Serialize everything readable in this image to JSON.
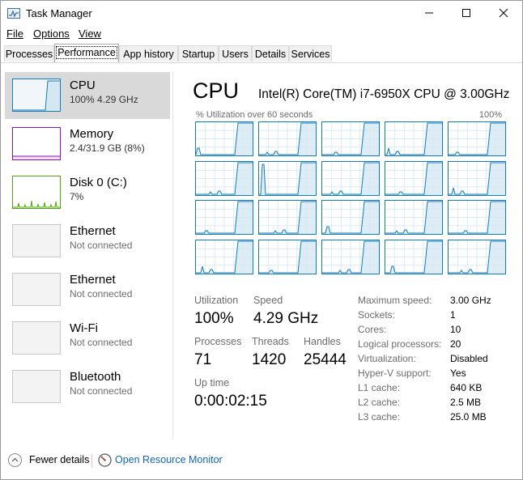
{
  "window": {
    "title": "Task Manager",
    "icon": "task-manager-icon"
  },
  "menu": [
    {
      "label": "File"
    },
    {
      "label": "Options"
    },
    {
      "label": "View"
    }
  ],
  "tabs": [
    {
      "label": "Processes"
    },
    {
      "label": "Performance",
      "active": true
    },
    {
      "label": "App history"
    },
    {
      "label": "Startup"
    },
    {
      "label": "Users"
    },
    {
      "label": "Details"
    },
    {
      "label": "Services"
    }
  ],
  "sidebar": {
    "items": [
      {
        "name": "CPU",
        "sub": "100% 4.29 GHz",
        "selected": true
      },
      {
        "name": "Memory",
        "sub": "2.4/31.9 GB (8%)"
      },
      {
        "name": "Disk 0 (C:)",
        "sub": "7%"
      },
      {
        "name": "Ethernet",
        "sub": "Not connected"
      },
      {
        "name": "Ethernet",
        "sub": "Not connected"
      },
      {
        "name": "Wi-Fi",
        "sub": "Not connected"
      },
      {
        "name": "Bluetooth",
        "sub": "Not connected"
      }
    ]
  },
  "main": {
    "title": "CPU",
    "model": "Intel(R) Core(TM) i7-6950X CPU @ 3.00GHz",
    "graph_caption": "% Utilization over 60 seconds",
    "graph_max": "100%",
    "logical_graph_count": 20,
    "stats": {
      "utilization_label": "Utilization",
      "utilization": "100%",
      "speed_label": "Speed",
      "speed": "4.29 GHz",
      "processes_label": "Processes",
      "processes": "71",
      "threads_label": "Threads",
      "threads": "1420",
      "handles_label": "Handles",
      "handles": "25444",
      "uptime_label": "Up time",
      "uptime": "0:00:02:15"
    },
    "details": [
      {
        "key": "Maximum speed:",
        "value": "3.00 GHz"
      },
      {
        "key": "Sockets:",
        "value": "1"
      },
      {
        "key": "Cores:",
        "value": "10"
      },
      {
        "key": "Logical processors:",
        "value": "20"
      },
      {
        "key": "Virtualization:",
        "value": "Disabled"
      },
      {
        "key": "Hyper-V support:",
        "value": "Yes"
      },
      {
        "key": "L1 cache:",
        "value": "640 KB"
      },
      {
        "key": "L2 cache:",
        "value": "2.5 MB"
      },
      {
        "key": "L3 cache:",
        "value": "25.0 MB"
      }
    ]
  },
  "footer": {
    "fewer_details": "Fewer details",
    "resource_monitor": "Open Resource Monitor"
  },
  "colors": {
    "cpu": "#117dbb",
    "memory": "#8b12ae",
    "disk": "#4da60c",
    "link": "#1464b4"
  }
}
